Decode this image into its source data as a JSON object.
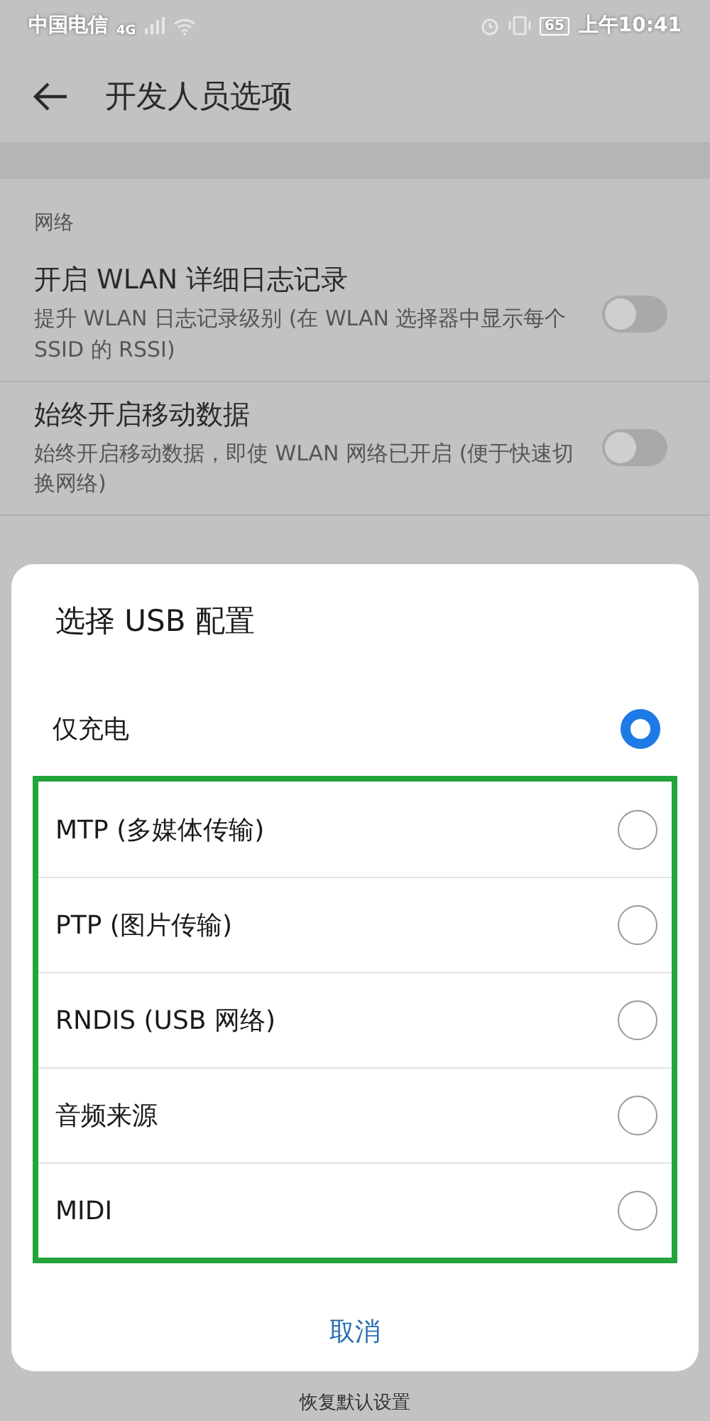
{
  "status_bar": {
    "carrier": "中国电信",
    "network": "4G",
    "battery": "65",
    "time": "上午10:41"
  },
  "header": {
    "title": "开发人员选项"
  },
  "section": {
    "title": "网络",
    "items": [
      {
        "title": "开启 WLAN 详细日志记录",
        "subtitle": "提升 WLAN 日志记录级别 (在 WLAN 选择器中显示每个 SSID 的 RSSI)",
        "on": false
      },
      {
        "title": "始终开启移动数据",
        "subtitle": "始终开启移动数据，即使 WLAN 网络已开启 (便于快速切换网络)",
        "on": false
      }
    ]
  },
  "dialog": {
    "title": "选择 USB 配置",
    "options": [
      {
        "label": "仅充电",
        "selected": true,
        "highlighted": false
      },
      {
        "label": "MTP (多媒体传输)",
        "selected": false,
        "highlighted": true
      },
      {
        "label": "PTP (图片传输)",
        "selected": false,
        "highlighted": true
      },
      {
        "label": "RNDIS (USB 网络)",
        "selected": false,
        "highlighted": true
      },
      {
        "label": "音频来源",
        "selected": false,
        "highlighted": true
      },
      {
        "label": "MIDI",
        "selected": false,
        "highlighted": true
      }
    ],
    "cancel": "取消"
  },
  "bottom_bar": {
    "label": "恢复默认设置"
  }
}
